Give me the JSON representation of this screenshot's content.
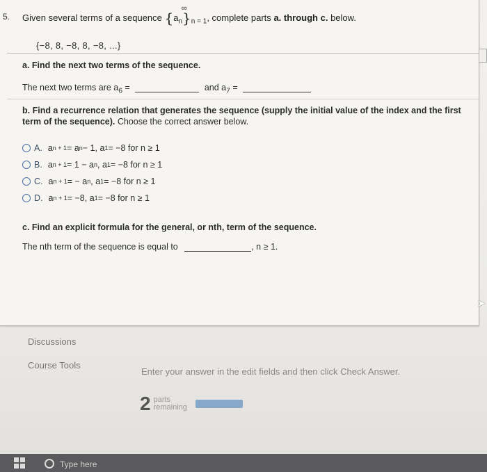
{
  "question": {
    "number": "5.",
    "header_pre": "Given several terms of a sequence",
    "header_seq_open": "{",
    "header_seq_var": "a",
    "header_seq_sub": "n",
    "header_seq_close": "}",
    "header_seq_range": "n = 1",
    "header_seq_inf": "∞",
    "header_post": ", complete parts",
    "header_bold": "a. through c.",
    "header_end": "below.",
    "sequence": "{−8, 8, −8, 8, −8, ...}"
  },
  "part_a": {
    "title": "a. Find the next two terms of the sequence.",
    "prompt_pre": "The next two terms are a",
    "prompt_sub1": "6",
    "prompt_eq": "=",
    "and_text": "and a",
    "prompt_sub2": "7",
    "prompt_eq2": "=",
    "answer_a6": "",
    "answer_a7": ""
  },
  "part_b": {
    "title": "b. Find a recurrence relation that generates the sequence (supply the initial value of the index and the first term of the sequence).",
    "instruction": "Choose the correct answer below.",
    "options": [
      {
        "letter": "A.",
        "text_html": [
          "a",
          "n + 1",
          " = a",
          "n",
          " − 1, a",
          "1",
          " = −8 for n ≥ 1"
        ]
      },
      {
        "letter": "B.",
        "text_html": [
          "a",
          "n + 1",
          " = 1 − a",
          "n",
          ", a",
          "1",
          " = −8 for n ≥ 1"
        ]
      },
      {
        "letter": "C.",
        "text_html": [
          "a",
          "n + 1",
          " = − a",
          "n",
          ", a",
          "1",
          " = −8 for n ≥ 1"
        ]
      },
      {
        "letter": "D.",
        "text_html": [
          "a",
          "n + 1",
          " = −8, a",
          "1",
          "",
          "",
          " = −8 for n ≥ 1"
        ]
      }
    ]
  },
  "part_c": {
    "title": "c. Find an explicit formula for the general, or nth, term of the sequence.",
    "prompt": "The nth term of the sequence is equal to",
    "suffix": ", n ≥ 1.",
    "answer": ""
  },
  "footer": {
    "discussions": "Discussions",
    "course_tools": "Course Tools",
    "instruction": "Enter your answer in the edit fields and then click Check Answer.",
    "parts_count": "2",
    "parts_label_1": "parts",
    "parts_label_2": "remaining"
  },
  "taskbar": {
    "search_hint": "Type here"
  },
  "colors": {
    "radio_border": "#4a6fa5",
    "progress_bar": "#86a9c9"
  }
}
